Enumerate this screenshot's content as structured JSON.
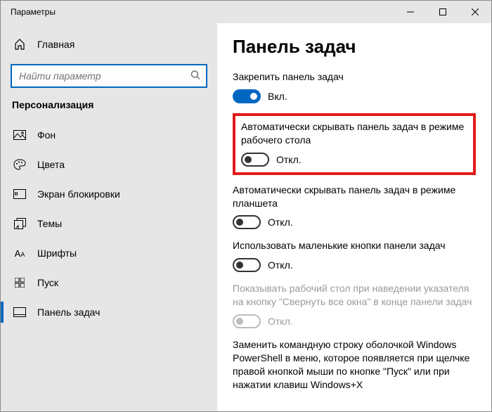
{
  "window": {
    "title": "Параметры"
  },
  "sidebar": {
    "home_label": "Главная",
    "search_placeholder": "Найти параметр",
    "section_label": "Персонализация",
    "items": [
      {
        "label": "Фон"
      },
      {
        "label": "Цвета"
      },
      {
        "label": "Экран блокировки"
      },
      {
        "label": "Темы"
      },
      {
        "label": "Шрифты"
      },
      {
        "label": "Пуск"
      },
      {
        "label": "Панель задач"
      }
    ]
  },
  "content": {
    "heading": "Панель задач",
    "settings": [
      {
        "label": "Закрепить панель задач",
        "state": "Вкл.",
        "on": true,
        "disabled": false
      },
      {
        "label": "Автоматически скрывать панель задач в режиме рабочего стола",
        "state": "Откл.",
        "on": false,
        "disabled": false
      },
      {
        "label": "Автоматически скрывать панель задач в режиме планшета",
        "state": "Откл.",
        "on": false,
        "disabled": false
      },
      {
        "label": "Использовать маленькие кнопки панели задач",
        "state": "Откл.",
        "on": false,
        "disabled": false
      },
      {
        "label": "Показывать рабочий стол при наведении указателя на кнопку \"Свернуть все окна\" в конце панели задач",
        "state": "Откл.",
        "on": false,
        "disabled": true
      },
      {
        "label": "Заменить командную строку оболочкой Windows PowerShell в меню, которое появляется при щелчке правой кнопкой мыши по кнопке \"Пуск\" или при нажатии клавиш Windows+X",
        "state": "",
        "on": false,
        "disabled": false
      }
    ]
  }
}
